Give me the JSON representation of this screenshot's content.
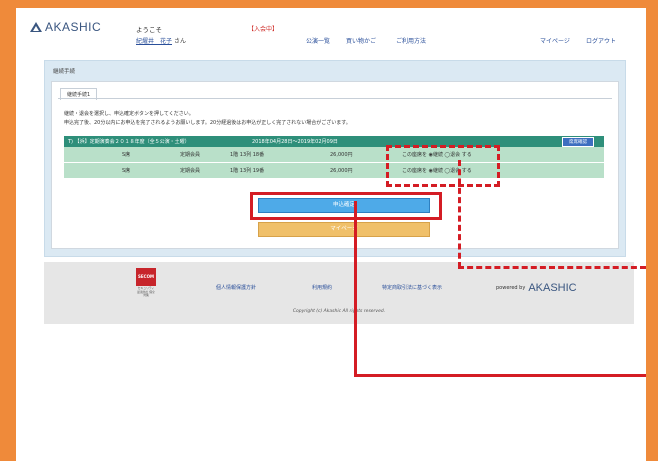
{
  "header": {
    "logo": "AKASHIC",
    "welcome": "ようこそ",
    "user_name": "紀燿井　花子",
    "user_suffix": "さん",
    "status": "【入会中】",
    "nav": [
      "公演一覧",
      "買い物かご",
      "ご利用方法",
      "マイページ",
      "ログアウト"
    ]
  },
  "panel": {
    "title": "継続手続",
    "tab": "継続手続1",
    "instructions": [
      "継続・退会を選択し、申込確定ボタンを押してください。",
      "申込完了後、20分以内にお申込を完了されるようお願いします。20分経過後はお申込が正しく完了されない場合がございます。"
    ],
    "table": {
      "head_name": "T) 【浜】定期演奏会２０１８年度（全５公演・土曜）",
      "head_period": "2018年04月28日～2019年02月09日",
      "confirm_label": "席席確認",
      "rows": [
        {
          "grade": "S席",
          "type": "定期会員",
          "seat": "1階 13列 18番",
          "price": "26,000円",
          "choice": "この座席を ◉継続 ◯退会 する"
        },
        {
          "grade": "S席",
          "type": "定期会員",
          "seat": "1階 13列 19番",
          "price": "26,000円",
          "choice": "この座席を ◉継続 ◯退会 する"
        }
      ]
    },
    "submit_label": "申込確定",
    "mypage_label": "マイページ"
  },
  "footer": {
    "secom": "SECOM",
    "secom_sub": "セキュリティ 最適化の 保全対策",
    "links": [
      "個人情報保護方針",
      "利用規約",
      "特定商取引法に基づく表示"
    ],
    "powered_by": "powered by",
    "powered_brand": "AKASHIC",
    "copyright": "Copyright (c) Akashic All rights reserved."
  }
}
